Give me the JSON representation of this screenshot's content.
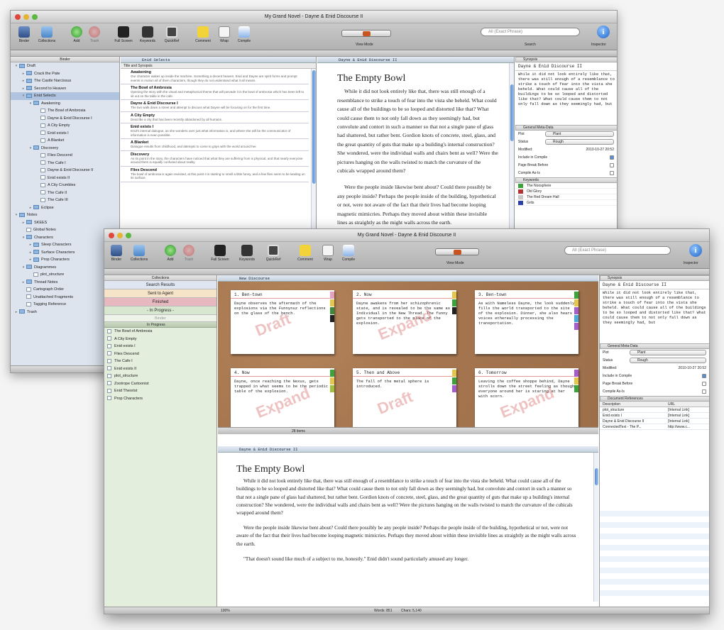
{
  "window1": {
    "title": "My Grand Novel - Dayne & Enid Discourse II",
    "toolbar": {
      "binder": "Binder",
      "collections": "Collections",
      "add": "Add",
      "trash": "Trash",
      "fullscreen": "Full Screen",
      "keywords": "Keywords",
      "quickref": "QuickRef",
      "comment": "Comment",
      "wrap": "Wrap",
      "compile": "Compile",
      "viewmode": "View Mode",
      "search_placeholder": "All (Exact Phrase)",
      "search_label": "Search",
      "inspector": "Inspector"
    },
    "binder_header": "Binder",
    "binder": [
      {
        "label": "Draft",
        "lvl": 0,
        "tri": "▾",
        "kind": "fo"
      },
      {
        "label": "Crack the Pate",
        "lvl": 1,
        "tri": "▸",
        "kind": "fo"
      },
      {
        "label": "The Castle Narcissus",
        "lvl": 1,
        "tri": "▸",
        "kind": "fo"
      },
      {
        "label": "Second to Heaven",
        "lvl": 1,
        "tri": "▸",
        "kind": "fo"
      },
      {
        "label": "Enid Selects",
        "lvl": 1,
        "tri": "▾",
        "kind": "fo",
        "sel": true
      },
      {
        "label": "Awakening",
        "lvl": 2,
        "tri": "▾",
        "kind": "fo"
      },
      {
        "label": "The Bowl of Ambrosia",
        "lvl": 3,
        "tri": "",
        "kind": "fi"
      },
      {
        "label": "Dayne & Enid Discourse I",
        "lvl": 3,
        "tri": "",
        "kind": "fi"
      },
      {
        "label": "A City Empty",
        "lvl": 3,
        "tri": "",
        "kind": "fi"
      },
      {
        "label": "Enid exists I",
        "lvl": 3,
        "tri": "",
        "kind": "fi"
      },
      {
        "label": "A Blanket",
        "lvl": 3,
        "tri": "",
        "kind": "fi"
      },
      {
        "label": "Discovery",
        "lvl": 2,
        "tri": "▾",
        "kind": "fo"
      },
      {
        "label": "Flies Descend",
        "lvl": 3,
        "tri": "",
        "kind": "fi"
      },
      {
        "label": "The Cafe I",
        "lvl": 3,
        "tri": "",
        "kind": "fi"
      },
      {
        "label": "Dayne & Enid Discourse II",
        "lvl": 3,
        "tri": "",
        "kind": "fi"
      },
      {
        "label": "Enid exists II",
        "lvl": 3,
        "tri": "",
        "kind": "fi"
      },
      {
        "label": "A City Crumbles",
        "lvl": 3,
        "tri": "",
        "kind": "fi"
      },
      {
        "label": "The Cafe II",
        "lvl": 3,
        "tri": "",
        "kind": "fi"
      },
      {
        "label": "The Cafe III",
        "lvl": 3,
        "tri": "",
        "kind": "fi"
      },
      {
        "label": "Eclipse",
        "lvl": 2,
        "tri": "▸",
        "kind": "fo"
      },
      {
        "label": "Notes",
        "lvl": 0,
        "tri": "▾",
        "kind": "fo"
      },
      {
        "label": "SKEES",
        "lvl": 1,
        "tri": "▸",
        "kind": "fo"
      },
      {
        "label": "Global Notes",
        "lvl": 1,
        "tri": "",
        "kind": "fi"
      },
      {
        "label": "Characters",
        "lvl": 1,
        "tri": "▾",
        "kind": "fo"
      },
      {
        "label": "Sleep Characters",
        "lvl": 2,
        "tri": "▸",
        "kind": "fo"
      },
      {
        "label": "Surface Characters",
        "lvl": 2,
        "tri": "▸",
        "kind": "fo"
      },
      {
        "label": "Prop Characters",
        "lvl": 2,
        "tri": "▸",
        "kind": "fo"
      },
      {
        "label": "Diagrammes",
        "lvl": 1,
        "tri": "▾",
        "kind": "fo"
      },
      {
        "label": "plot_structure",
        "lvl": 2,
        "tri": "",
        "kind": "fi"
      },
      {
        "label": "Thread Notes",
        "lvl": 1,
        "tri": "▸",
        "kind": "fo"
      },
      {
        "label": "Cartograph Order",
        "lvl": 1,
        "tri": "",
        "kind": "fi"
      },
      {
        "label": "Unattached Fragments",
        "lvl": 1,
        "tri": "",
        "kind": "fi"
      },
      {
        "label": "Tagging Reference",
        "lvl": 1,
        "tri": "",
        "kind": "fi"
      },
      {
        "label": "Trash",
        "lvl": 0,
        "tri": "▸",
        "kind": "fo"
      }
    ],
    "outline_header": "Enid Selects",
    "outline_cols": "Title and Synopsis",
    "outline": [
      {
        "t": "Awakening",
        "d": "Our character wakes up inside the machine. Something a decent heaven. Enid and Dayne are spirit forms and prompt events in motion all of them characters, though they do not understand what it all means."
      },
      {
        "t": "The Bowl of Ambrosia",
        "d": "Opening the story with the visual and metaphorical theme that will pervade it in the bowl of ambrosia which has been left to sit out on the table in the cafe."
      },
      {
        "t": "Dayne & Enid Discourse I",
        "d": "The two walk down a street and attempt to discuss what Dayne will be focusing on for the first time."
      },
      {
        "t": "A City Empty",
        "d": "Describe a city that has been recently abandoned by all humans."
      },
      {
        "t": "Enid exists I",
        "d": "Enid's internal dialogue, as she wonders over just what information is, and where she will be the communicator of information is even possible."
      },
      {
        "t": "A Blanket",
        "d": "Dialogue results from childhood, and attempts to come to grips with the world around her."
      },
      {
        "t": "Discovery",
        "d": "As its point in the story, the characters have noticed that what they are suffering from is physical, and that nearly everyone around them is equally confused about reality."
      },
      {
        "t": "Flies Descend",
        "d": "The bowl of ambrosia is again revisited, at this point it is starting to smell a little funny, and a few flies seem to be landing on its surface."
      }
    ],
    "editor_header": "Dayne & Enid Discourse II",
    "doc_title": "The Empty Bowl",
    "doc_p1": "While it did not look entirely like that, there was still enough of a resemblance to strike a touch of fear into the vista she beheld. What could cause all of the buildings to be so looped and distorted like that? What could cause them to not only fall down as they seemingly had, but convolute and contort in such a manner so that not a single pane of glass had shattered, but rather bent. Gordion knots of concrete, steel, glass, and the great quantity of guts that make up a building's internal construction? She wondered, were the individual walls and chairs bent as well? Were the pictures hanging on the walls twisted to match the curvature of the cubicals wrapped around them?",
    "doc_p2": "Were the people inside likewise bent about? Could there possibly be any people inside? Perhaps the people inside of the building, hypothetical or not, were not aware of the fact that their lives had become looping magnetic mimicries. Perhaps they moved about within these invisible lines as straightly as the might walls across the earth.",
    "insp_synopsis_title": "Synopsis",
    "insp_synopsis_name": "Dayne & Enid Discourse II",
    "insp_synopsis_text": "While it did not look entirely like that, there was still enough of a resemblance to strike a touch of fear into the vista she beheld. What could cause all of the buildings to be so looped and distorted like that? What could cause them to not only fall down as they seemingly had, but",
    "meta_title": "General Meta-Data",
    "meta": {
      "label_lbl": "Plot",
      "label_val": "Plant",
      "status_lbl": "Status",
      "status_val": "Rough",
      "modified_lbl": "Modified:",
      "modified_val": "2010-10-27 20:52",
      "incl": "Include in Compile",
      "pb": "Page Break Before",
      "compile_as": "Compile As-Is"
    },
    "keywords_title": "Keywords",
    "keywords": [
      {
        "label": "The Noosphere",
        "color": "#3aa33a"
      },
      {
        "label": "Old Glory",
        "color": "#b33232"
      },
      {
        "label": "The Red Dream Hall",
        "color": "#c8c8c8"
      },
      {
        "label": "Grits",
        "color": "#2a3fa8"
      }
    ]
  },
  "window2": {
    "title": "My Grand Novel - Dayne & Enid Discourse II",
    "collections_header": "Collections",
    "collections": [
      {
        "label": "Search Results",
        "bg": "#dfe6f2"
      },
      {
        "label": "Sent to Agent",
        "bg": "#f6e4c8"
      },
      {
        "label": "Finished",
        "bg": "#e8b8c0"
      },
      {
        "label": "- In Progress -",
        "bg": "#d8e8d0"
      }
    ],
    "binder_mini": "Binder",
    "inprogress_title": "In Progress",
    "inprogress": [
      "The Bowl of Ambrosia",
      "A City Empty",
      "Enid exists I",
      "Flies Descend",
      "The Cafe I",
      "Enid exists II",
      "plot_structure",
      "Zootrope Cartoonist",
      "Enid Theorist",
      "Prop Characters"
    ],
    "cork_header": "New Discourse",
    "cards": [
      {
        "title": "1. Ben-town",
        "body": "Dayne observes the aftermath of the explosions via the Funnynuz reflections on the glass of the bench.",
        "stamp": "Draft",
        "tabs": [
          "#e8a0c0",
          "#e6c64a",
          "#3a8a3a",
          "#222"
        ]
      },
      {
        "title": "2. Now",
        "body": "Dayne awakens from her schizophrenic state, and is revealed to be the same as Individual in the New Thread. The funny gets transported to the place of the explosion.",
        "stamp": "Expand",
        "tabs": [
          "#e6c64a",
          "#3aa33a",
          "#222"
        ]
      },
      {
        "title": "3. Ben-town",
        "body": "As with Nameless Dayne, the look suddenly fills the world transported to the site of the explosion. Dinner, she also hears voices ethereally processing the transportation.",
        "stamp": "",
        "tabs": [
          "#3aa33a",
          "#e6c64a",
          "#a85ad0",
          "#4aaae0",
          "#a85ad0"
        ]
      },
      {
        "title": "4. Now",
        "body": "Dayne, once reaching the Nexus, gets trapped in what seems to be the periodic table of the explosion.",
        "stamp": "Expand",
        "tabs": [
          "#3aa33a",
          "#e6c64a",
          "#a0c040"
        ]
      },
      {
        "title": "5. Then and Above",
        "body": "The fall of the metal sphere is introduced.",
        "stamp": "Draft",
        "tabs": [
          "#e6c64a",
          "#3aa33a",
          "#a85ad0"
        ]
      },
      {
        "title": "6. Tomorrow",
        "body": "Leaving the coffee shoppe behind, Dayne strolls down the street feeling as though everyone around her is staring at her with scorn.",
        "stamp": "Expand",
        "tabs": [
          "#a85ad0",
          "#e6c64a",
          "#3aa33a"
        ]
      }
    ],
    "cork_footer": "28 items",
    "editor_header": "Dayne & Enid Discourse II",
    "doc_title": "The Empty Bowl",
    "doc_p1": "While it did not look entirely like that, there was still enough of a resemblance to strike a touch of fear into the vista she beheld. What could cause all of the buildings to be so looped and distorted like that? What could cause them to not only fall down as they seemingly had, but convolute and contort in such a manner so that not a single pane of glass had shattered, but rather bent. Gordion knots of concrete, steel, glass, and the great quantity of guts that make up a building's internal construction? She wondered, were the individual walls and chairs bent as well? Were the pictures hanging on the walls twisted to match the curvature of the cubicals wrapped around them?",
    "doc_p2": "Were the people inside likewise bent about? Could there possibly be any people inside? Perhaps the people inside of the building, hypothetical or not, were not aware of the fact that their lives had become looping magnetic mimicries. Perhaps they moved about within these invisible lines as straightly as the might walls across the earth.",
    "doc_p3": "\"That doesn't sound like much of a subject to me, honestly.\" Enid didn't sound particularly amused any longer.",
    "status_zoom": "100%",
    "status_words": "Words: 851",
    "status_chars": "Chars: 5,140",
    "insp_synopsis_name": "Dayne & Enid Discourse II",
    "insp_synopsis_text": "While it did not look entirely like that, there was still enough of a resemblance to strike a touch of fear into the vista she beheld. What could cause all of the buildings to be so looped and distorted like that? What could cause them to not only fall down as they seemingly had, but",
    "docref_title": "Document References",
    "docref_cols": [
      "Description",
      "URL"
    ],
    "docrefs": [
      {
        "d": "plot_structure",
        "u": "[Internal Link]"
      },
      {
        "d": "Enid exists I",
        "u": "[Internal Link]"
      },
      {
        "d": "Dayne & Enid Discourse II",
        "u": "[Internal Link]"
      },
      {
        "d": "ConnectedText - The P...",
        "u": "http://www.c..."
      }
    ]
  }
}
